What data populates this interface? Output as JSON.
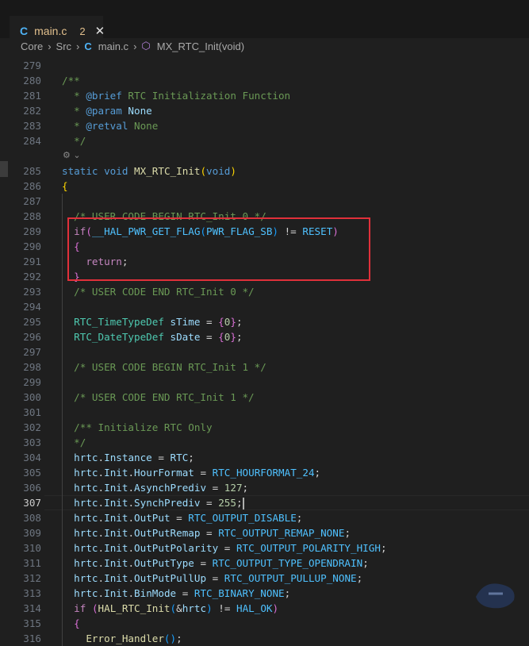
{
  "tab": {
    "icon": "C",
    "filename": "main.c",
    "problem_count": "2",
    "close": "✕"
  },
  "breadcrumb": {
    "parts": [
      "Core",
      "Src",
      "main.c",
      "MX_RTC_Init(void)"
    ],
    "file_icon": "C"
  },
  "editor": {
    "active_line": 307,
    "codelens": "⚙ ⌄",
    "lines": [
      {
        "n": "279",
        "html": "<span class=\"plain\"></span>"
      },
      {
        "n": "280",
        "html": "<span class=\"cm\">/**</span>"
      },
      {
        "n": "281",
        "html": "<span class=\"cm\">  * </span><span class=\"kw\">@brief</span><span class=\"cm\"> RTC Initialization Function</span>"
      },
      {
        "n": "282",
        "html": "<span class=\"cm\">  * </span><span class=\"kw\">@param</span><span class=\"var\"> None</span>"
      },
      {
        "n": "283",
        "html": "<span class=\"cm\">  * </span><span class=\"kw\">@retval</span><span class=\"cm\"> None</span>"
      },
      {
        "n": "284",
        "html": "<span class=\"cm\">  */</span>"
      },
      {
        "n": "",
        "html": ""
      },
      {
        "n": "285",
        "html": "<span class=\"kw\">static</span> <span class=\"kw\">void</span> <span class=\"fn\">MX_RTC_Init</span><span class=\"br1\">(</span><span class=\"kw\">void</span><span class=\"br1\">)</span>"
      },
      {
        "n": "286",
        "html": "<span class=\"br1\">{</span>"
      },
      {
        "n": "287",
        "html": ""
      },
      {
        "n": "288",
        "html": "  <span class=\"cm\">/* USER CODE BEGIN RTC_Init 0 */</span>"
      },
      {
        "n": "289",
        "html": "  <span class=\"ctl\">if</span><span class=\"br2\">(</span><span class=\"mac\">__HAL_PWR_GET_FLAG</span><span class=\"br3\">(</span><span class=\"mac\">PWR_FLAG_SB</span><span class=\"br3\">)</span><span class=\"op\"> != </span><span class=\"mac\">RESET</span><span class=\"br2\">)</span>"
      },
      {
        "n": "290",
        "html": "  <span class=\"br2\">{</span>"
      },
      {
        "n": "291",
        "html": "    <span class=\"ctl\">return</span><span class=\"op\">;</span>"
      },
      {
        "n": "292",
        "html": "  <span class=\"br2\">}</span>"
      },
      {
        "n": "293",
        "html": "  <span class=\"cm\">/* USER CODE END RTC_Init 0 */</span>"
      },
      {
        "n": "294",
        "html": ""
      },
      {
        "n": "295",
        "html": "  <span class=\"ty\">RTC_TimeTypeDef</span> <span class=\"var\">sTime</span><span class=\"op\"> = </span><span class=\"br2\">{</span><span class=\"num\">0</span><span class=\"br2\">}</span><span class=\"op\">;</span>"
      },
      {
        "n": "296",
        "html": "  <span class=\"ty\">RTC_DateTypeDef</span> <span class=\"var\">sDate</span><span class=\"op\"> = </span><span class=\"br2\">{</span><span class=\"num\">0</span><span class=\"br2\">}</span><span class=\"op\">;</span>"
      },
      {
        "n": "297",
        "html": ""
      },
      {
        "n": "298",
        "html": "  <span class=\"cm\">/* USER CODE BEGIN RTC_Init 1 */</span>"
      },
      {
        "n": "299",
        "html": ""
      },
      {
        "n": "300",
        "html": "  <span class=\"cm\">/* USER CODE END RTC_Init 1 */</span>"
      },
      {
        "n": "301",
        "html": ""
      },
      {
        "n": "302",
        "html": "  <span class=\"cm\">/** Initialize RTC Only</span>"
      },
      {
        "n": "303",
        "html": "  <span class=\"cm\">*/</span>"
      },
      {
        "n": "304",
        "html": "  <span class=\"var\">hrtc</span><span class=\"op\">.</span><span class=\"var\">Instance</span><span class=\"op\"> = </span><span class=\"var\">RTC</span><span class=\"op\">;</span>"
      },
      {
        "n": "305",
        "html": "  <span class=\"var\">hrtc</span><span class=\"op\">.</span><span class=\"var\">Init</span><span class=\"op\">.</span><span class=\"var\">HourFormat</span><span class=\"op\"> = </span><span class=\"mac\">RTC_HOURFORMAT_24</span><span class=\"op\">;</span>"
      },
      {
        "n": "306",
        "html": "  <span class=\"var\">hrtc</span><span class=\"op\">.</span><span class=\"var\">Init</span><span class=\"op\">.</span><span class=\"var\">AsynchPrediv</span><span class=\"op\"> = </span><span class=\"num\">127</span><span class=\"op\">;</span>"
      },
      {
        "n": "307",
        "html": "  <span class=\"var\">hrtc</span><span class=\"op\">.</span><span class=\"var\">Init</span><span class=\"op\">.</span><span class=\"var\">SynchPrediv</span><span class=\"op\"> = </span><span class=\"num\">255</span><span class=\"op\">;</span><span class=\"cursor\"></span>"
      },
      {
        "n": "308",
        "html": "  <span class=\"var\">hrtc</span><span class=\"op\">.</span><span class=\"var\">Init</span><span class=\"op\">.</span><span class=\"var\">OutPut</span><span class=\"op\"> = </span><span class=\"mac\">RTC_OUTPUT_DISABLE</span><span class=\"op\">;</span>"
      },
      {
        "n": "309",
        "html": "  <span class=\"var\">hrtc</span><span class=\"op\">.</span><span class=\"var\">Init</span><span class=\"op\">.</span><span class=\"var\">OutPutRemap</span><span class=\"op\"> = </span><span class=\"mac\">RTC_OUTPUT_REMAP_NONE</span><span class=\"op\">;</span>"
      },
      {
        "n": "310",
        "html": "  <span class=\"var\">hrtc</span><span class=\"op\">.</span><span class=\"var\">Init</span><span class=\"op\">.</span><span class=\"var\">OutPutPolarity</span><span class=\"op\"> = </span><span class=\"mac\">RTC_OUTPUT_POLARITY_HIGH</span><span class=\"op\">;</span>"
      },
      {
        "n": "311",
        "html": "  <span class=\"var\">hrtc</span><span class=\"op\">.</span><span class=\"var\">Init</span><span class=\"op\">.</span><span class=\"var\">OutPutType</span><span class=\"op\"> = </span><span class=\"mac\">RTC_OUTPUT_TYPE_OPENDRAIN</span><span class=\"op\">;</span>"
      },
      {
        "n": "312",
        "html": "  <span class=\"var\">hrtc</span><span class=\"op\">.</span><span class=\"var\">Init</span><span class=\"op\">.</span><span class=\"var\">OutPutPullUp</span><span class=\"op\"> = </span><span class=\"mac\">RTC_OUTPUT_PULLUP_NONE</span><span class=\"op\">;</span>"
      },
      {
        "n": "313",
        "html": "  <span class=\"var\">hrtc</span><span class=\"op\">.</span><span class=\"var\">Init</span><span class=\"op\">.</span><span class=\"var\">BinMode</span><span class=\"op\"> = </span><span class=\"mac\">RTC_BINARY_NONE</span><span class=\"op\">;</span>"
      },
      {
        "n": "314",
        "html": "  <span class=\"ctl\">if</span> <span class=\"br2\">(</span><span class=\"fn\">HAL_RTC_Init</span><span class=\"br3\">(</span><span class=\"op\">&amp;</span><span class=\"var\">hrtc</span><span class=\"br3\">)</span><span class=\"op\"> != </span><span class=\"mac\">HAL_OK</span><span class=\"br2\">)</span>"
      },
      {
        "n": "315",
        "html": "  <span class=\"br2\">{</span>"
      },
      {
        "n": "316",
        "html": "    <span class=\"fn\">Error_Handler</span><span class=\"br3\">()</span><span class=\"op\">;</span>"
      }
    ]
  },
  "colors": {
    "background": "#1f1f1f",
    "tab_bar": "#181818",
    "highlight_box": "#e0303a",
    "modified_file": "#e2c08d"
  }
}
